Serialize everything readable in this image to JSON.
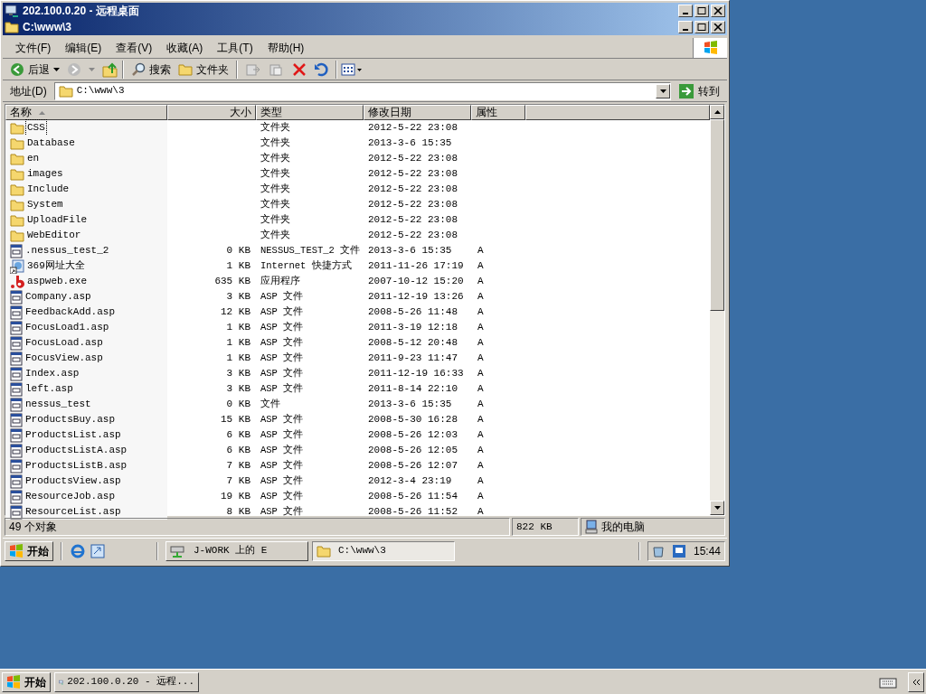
{
  "remote_window": {
    "title": "202.100.0.20 - 远程桌面"
  },
  "explorer": {
    "title": "C:\\www\\3",
    "menu": [
      "文件(F)",
      "编辑(E)",
      "查看(V)",
      "收藏(A)",
      "工具(T)",
      "帮助(H)"
    ],
    "toolbar": {
      "back": "后退",
      "search": "搜索",
      "folders": "文件夹"
    },
    "address": {
      "label": "地址(D)",
      "value": "C:\\www\\3",
      "go": "转到"
    },
    "columns": [
      "名称",
      "大小",
      "类型",
      "修改日期",
      "属性"
    ],
    "rows": [
      {
        "kind": "folder",
        "name": "CSS",
        "size": "",
        "type": "文件夹",
        "modified": "2012-5-22 23:08",
        "attributes": "",
        "focused": true
      },
      {
        "kind": "folder",
        "name": "Database",
        "size": "",
        "type": "文件夹",
        "modified": "2013-3-6 15:35",
        "attributes": "",
        "focused": false
      },
      {
        "kind": "folder",
        "name": "en",
        "size": "",
        "type": "文件夹",
        "modified": "2012-5-22 23:08",
        "attributes": "",
        "focused": false
      },
      {
        "kind": "folder",
        "name": "images",
        "size": "",
        "type": "文件夹",
        "modified": "2012-5-22 23:08",
        "attributes": "",
        "focused": false
      },
      {
        "kind": "folder",
        "name": "Include",
        "size": "",
        "type": "文件夹",
        "modified": "2012-5-22 23:08",
        "attributes": "",
        "focused": false
      },
      {
        "kind": "folder",
        "name": "System",
        "size": "",
        "type": "文件夹",
        "modified": "2012-5-22 23:08",
        "attributes": "",
        "focused": false
      },
      {
        "kind": "folder",
        "name": "UploadFile",
        "size": "",
        "type": "文件夹",
        "modified": "2012-5-22 23:08",
        "attributes": "",
        "focused": false
      },
      {
        "kind": "folder",
        "name": "WebEditor",
        "size": "",
        "type": "文件夹",
        "modified": "2012-5-22 23:08",
        "attributes": "",
        "focused": false
      },
      {
        "kind": "file",
        "name": ".nessus_test_2",
        "size": "0 KB",
        "type": "NESSUS_TEST_2 文件",
        "modified": "2013-3-6 15:35",
        "attributes": "A",
        "focused": false
      },
      {
        "kind": "shortcut",
        "name": "369网址大全",
        "size": "1 KB",
        "type": "Internet 快捷方式",
        "modified": "2011-11-26 17:19",
        "attributes": "A",
        "focused": false
      },
      {
        "kind": "exe",
        "name": "aspweb.exe",
        "size": "635 KB",
        "type": "应用程序",
        "modified": "2007-10-12 15:20",
        "attributes": "A",
        "focused": false
      },
      {
        "kind": "file",
        "name": "Company.asp",
        "size": "3 KB",
        "type": "ASP 文件",
        "modified": "2011-12-19 13:26",
        "attributes": "A",
        "focused": false
      },
      {
        "kind": "file",
        "name": "FeedbackAdd.asp",
        "size": "12 KB",
        "type": "ASP 文件",
        "modified": "2008-5-26 11:48",
        "attributes": "A",
        "focused": false
      },
      {
        "kind": "file",
        "name": "FocusLoad1.asp",
        "size": "1 KB",
        "type": "ASP 文件",
        "modified": "2011-3-19 12:18",
        "attributes": "A",
        "focused": false
      },
      {
        "kind": "file",
        "name": "FocusLoad.asp",
        "size": "1 KB",
        "type": "ASP 文件",
        "modified": "2008-5-12 20:48",
        "attributes": "A",
        "focused": false
      },
      {
        "kind": "file",
        "name": "FocusView.asp",
        "size": "1 KB",
        "type": "ASP 文件",
        "modified": "2011-9-23 11:47",
        "attributes": "A",
        "focused": false
      },
      {
        "kind": "file",
        "name": "Index.asp",
        "size": "3 KB",
        "type": "ASP 文件",
        "modified": "2011-12-19 16:33",
        "attributes": "A",
        "focused": false
      },
      {
        "kind": "file",
        "name": "left.asp",
        "size": "3 KB",
        "type": "ASP 文件",
        "modified": "2011-8-14 22:10",
        "attributes": "A",
        "focused": false
      },
      {
        "kind": "file",
        "name": "nessus_test",
        "size": "0 KB",
        "type": "文件",
        "modified": "2013-3-6 15:35",
        "attributes": "A",
        "focused": false
      },
      {
        "kind": "file",
        "name": "ProductsBuy.asp",
        "size": "15 KB",
        "type": "ASP 文件",
        "modified": "2008-5-30 16:28",
        "attributes": "A",
        "focused": false
      },
      {
        "kind": "file",
        "name": "ProductsList.asp",
        "size": "6 KB",
        "type": "ASP 文件",
        "modified": "2008-5-26 12:03",
        "attributes": "A",
        "focused": false
      },
      {
        "kind": "file",
        "name": "ProductsListA.asp",
        "size": "6 KB",
        "type": "ASP 文件",
        "modified": "2008-5-26 12:05",
        "attributes": "A",
        "focused": false
      },
      {
        "kind": "file",
        "name": "ProductsListB.asp",
        "size": "7 KB",
        "type": "ASP 文件",
        "modified": "2008-5-26 12:07",
        "attributes": "A",
        "focused": false
      },
      {
        "kind": "file",
        "name": "ProductsView.asp",
        "size": "7 KB",
        "type": "ASP 文件",
        "modified": "2012-3-4 23:19",
        "attributes": "A",
        "focused": false
      },
      {
        "kind": "file",
        "name": "ResourceJob.asp",
        "size": "19 KB",
        "type": "ASP 文件",
        "modified": "2008-5-26 11:54",
        "attributes": "A",
        "focused": false
      },
      {
        "kind": "file",
        "name": "ResourceList.asp",
        "size": "8 KB",
        "type": "ASP 文件",
        "modified": "2008-5-26 11:52",
        "attributes": "A",
        "focused": false
      }
    ],
    "status_bar": {
      "count": "49 个对象",
      "size": "822 KB",
      "zone": "我的电脑"
    }
  },
  "remote_taskbar": {
    "start": "开始",
    "tasks": [
      {
        "kind": "drive",
        "label": "J-WORK 上的 E",
        "selected": false
      },
      {
        "kind": "folder",
        "label": "C:\\www\\3",
        "selected": true
      }
    ],
    "clock": "15:44"
  },
  "taskbar": {
    "start": "开始",
    "tasks": [
      {
        "label": "202.100.0.20 - 远程...",
        "selected": false
      }
    ]
  }
}
